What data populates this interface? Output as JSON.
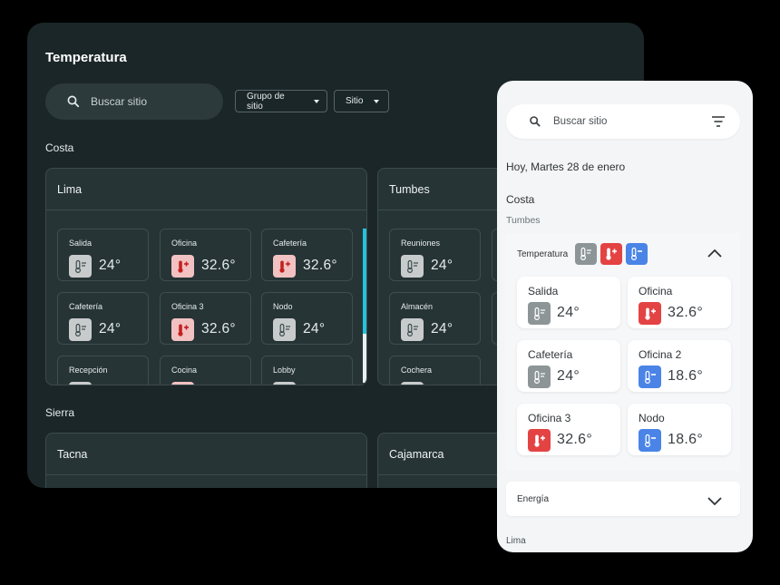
{
  "desktop": {
    "title": "Temperatura",
    "search_placeholder": "Buscar sitio",
    "filters": {
      "group": "Grupo de sitio",
      "site": "Sitio"
    },
    "regions": [
      {
        "name": "Costa",
        "sites": [
          {
            "name": "Lima",
            "tiles": [
              {
                "name": "Salida",
                "value": "24°",
                "status": "normal"
              },
              {
                "name": "Oficina",
                "value": "32.6°",
                "status": "high"
              },
              {
                "name": "Cafetería",
                "value": "32.6°",
                "status": "high"
              },
              {
                "name": "Cafetería",
                "value": "24°",
                "status": "normal"
              },
              {
                "name": "Oficina 3",
                "value": "32.6°",
                "status": "high"
              },
              {
                "name": "Nodo",
                "value": "24°",
                "status": "normal"
              },
              {
                "name": "Recepción",
                "value": "",
                "status": "normal"
              },
              {
                "name": "Cocina",
                "value": "",
                "status": "high"
              },
              {
                "name": "Lobby",
                "value": "",
                "status": "normal"
              }
            ]
          },
          {
            "name": "Tumbes",
            "tiles": [
              {
                "name": "Reuniones",
                "value": "24°",
                "status": "normal"
              },
              {
                "name": "Almacén",
                "value": "24°",
                "status": "normal"
              },
              {
                "name": "Cochera",
                "value": "",
                "status": "normal"
              }
            ]
          }
        ]
      },
      {
        "name": "Sierra",
        "sites": [
          {
            "name": "Tacna"
          },
          {
            "name": "Cajamarca"
          }
        ]
      }
    ]
  },
  "mobile": {
    "search_placeholder": "Buscar sitio",
    "date": "Hoy, Martes 28 de enero",
    "region": "Costa",
    "site": "Tumbes",
    "temperature_section": {
      "label": "Temperatura",
      "tiles": [
        {
          "name": "Salida",
          "value": "24°",
          "status": "normal"
        },
        {
          "name": "Oficina",
          "value": "32.6°",
          "status": "high"
        },
        {
          "name": "Cafetería",
          "value": "24°",
          "status": "normal"
        },
        {
          "name": "Oficina 2",
          "value": "18.6°",
          "status": "cold"
        },
        {
          "name": "Oficina 3",
          "value": "32.6°",
          "status": "high"
        },
        {
          "name": "Nodo",
          "value": "18.6°",
          "status": "cold"
        }
      ]
    },
    "energy_section": {
      "label": "Energía"
    },
    "next_site": "Lima"
  },
  "colors": {
    "accent": "#24c2db",
    "high": "#e44343",
    "cold": "#4a84e6",
    "normal": "#8d9597"
  },
  "icons": [
    "search-icon",
    "filter-icon",
    "thermometer-icon",
    "thermometer-plus-icon",
    "thermometer-minus-icon",
    "chevron-up-icon",
    "chevron-down-icon",
    "caret-down-icon"
  ]
}
